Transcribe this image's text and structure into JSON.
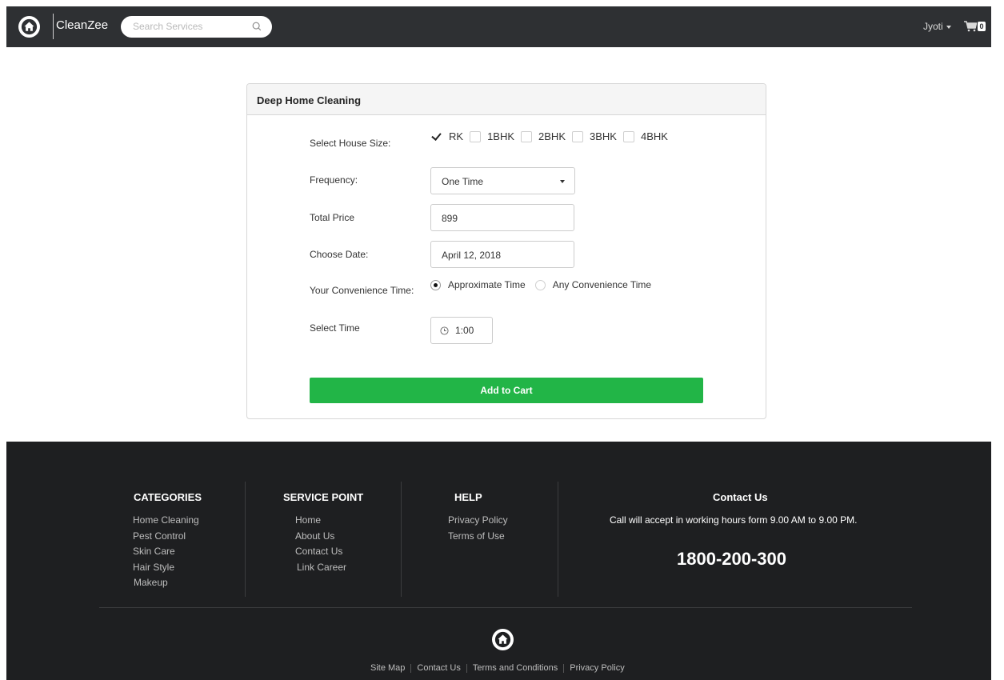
{
  "navbar": {
    "brand": "CleanZee",
    "search_placeholder": "Search Services",
    "user": "Jyoti",
    "cart_count": "0"
  },
  "form": {
    "title": "Deep Home Cleaning",
    "house_size_label": "Select House Size:",
    "house_sizes": [
      {
        "label": "RK",
        "checked": true
      },
      {
        "label": "1BHK",
        "checked": false
      },
      {
        "label": "2BHK",
        "checked": false
      },
      {
        "label": "3BHK",
        "checked": false
      },
      {
        "label": "4BHK",
        "checked": false
      }
    ],
    "frequency_label": "Frequency:",
    "frequency_value": "One Time",
    "price_label": "Total Price",
    "price_value": "899",
    "date_label": "Choose Date:",
    "date_value": "April 12, 2018",
    "convenience_label": "Your Convenience Time:",
    "convenience_options": [
      {
        "label": "Approximate Time",
        "selected": true
      },
      {
        "label": "Any Convenience Time",
        "selected": false
      }
    ],
    "time_label": "Select Time",
    "time_value": "1:00",
    "submit_label": "Add to Cart"
  },
  "footer": {
    "categories": {
      "title": "CATEGORIES",
      "links": [
        "Home Cleaning",
        "Pest Control",
        "Skin Care",
        "Hair Style",
        "Makeup"
      ]
    },
    "service_point": {
      "title": "SERVICE POINT",
      "links": [
        "Home",
        "About Us",
        "Contact Us",
        "Link Career"
      ]
    },
    "help": {
      "title": "HELP",
      "links": [
        "Privacy Policy",
        "Terms of Use"
      ]
    },
    "contact": {
      "title": "Contact Us",
      "text": "Call will accept in working hours form 9.00 AM to 9.00 PM.",
      "phone": "1800-200-300"
    },
    "bottom_links": [
      "Site Map",
      "Contact Us",
      "Terms and Conditions",
      "Privacy Policy"
    ]
  },
  "colors": {
    "navbar": "#2e3033",
    "footer": "#1e1f21",
    "button": "#22b547"
  }
}
